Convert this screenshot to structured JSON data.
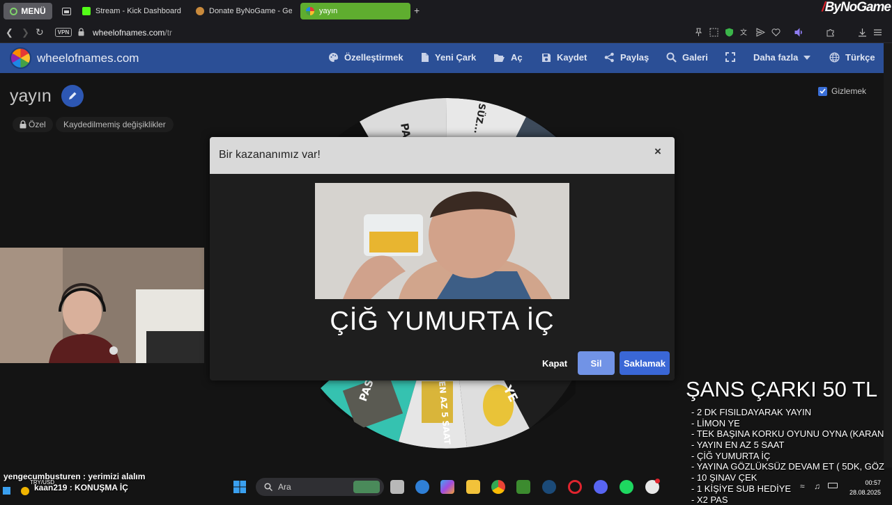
{
  "browser": {
    "menu_label": "MENÜ",
    "tabs": [
      {
        "title": "Stream - Kick Dashboard"
      },
      {
        "title": "Donate ByNoGame - Gele"
      },
      {
        "title": "yayın"
      }
    ],
    "brand": "ByNoGame",
    "vpn_label": "VPN",
    "url_host": "wheelofnames.com",
    "url_path": "/tr"
  },
  "site": {
    "name": "wheelofnames.com",
    "nav": {
      "customize": "Özelleştirmek",
      "new_wheel": "Yeni Çark",
      "open": "Aç",
      "save": "Kaydet",
      "share": "Paylaş",
      "gallery": "Galeri",
      "more": "Daha fazla",
      "language": "Türkçe"
    }
  },
  "page": {
    "wheel_title": "yayın",
    "private_label": "Özel",
    "unsaved_label": "Kaydedilmemiş değişiklikler",
    "hide_label": "Gizlemek",
    "hide_checked": true
  },
  "wheel": {
    "visible_segments": [
      "PAS",
      "SÜZ...",
      "PAS",
      "EN AZ 5 SAAT",
      "YE"
    ]
  },
  "modal": {
    "title": "Bir kazananımız var!",
    "close_icon": "×",
    "winner": "ÇİĞ YUMURTA İÇ",
    "buttons": {
      "close": "Kapat",
      "delete": "Sil",
      "hide": "Saklamak"
    }
  },
  "overlay": {
    "title": "ŞANS ÇARKI 50 TL",
    "items": [
      "- 2 DK FISILDAYARAK YAYIN",
      "- LİMON YE",
      "- TEK BAŞINA KORKU OYUNU OYNA (KARAN",
      "- YAYIN EN AZ 5 SAAT",
      "- ÇİĞ YUMURTA İÇ",
      "- YAYINA GÖZLÜKSÜZ DEVAM ET ( 5DK, GÖZ",
      "- 10 ŞINAV ÇEK",
      "- 1 KİŞİYE SUB HEDİYE",
      "- X2 PAS"
    ]
  },
  "chat": [
    {
      "user": "yengecumbusturen",
      "message": "yerimizi alalım"
    },
    {
      "user": "kaan219",
      "message": "KONUŞMA İÇ"
    }
  ],
  "ticker": "TRY/USD",
  "taskbar": {
    "search_placeholder": "Ara",
    "time": "00:57",
    "date": "28.08.2025"
  },
  "colors": {
    "header_blue": "#2b4f96",
    "active_tab_green": "#5fad2f",
    "primary_button": "#3a67d6",
    "secondary_button": "#7193e6"
  }
}
